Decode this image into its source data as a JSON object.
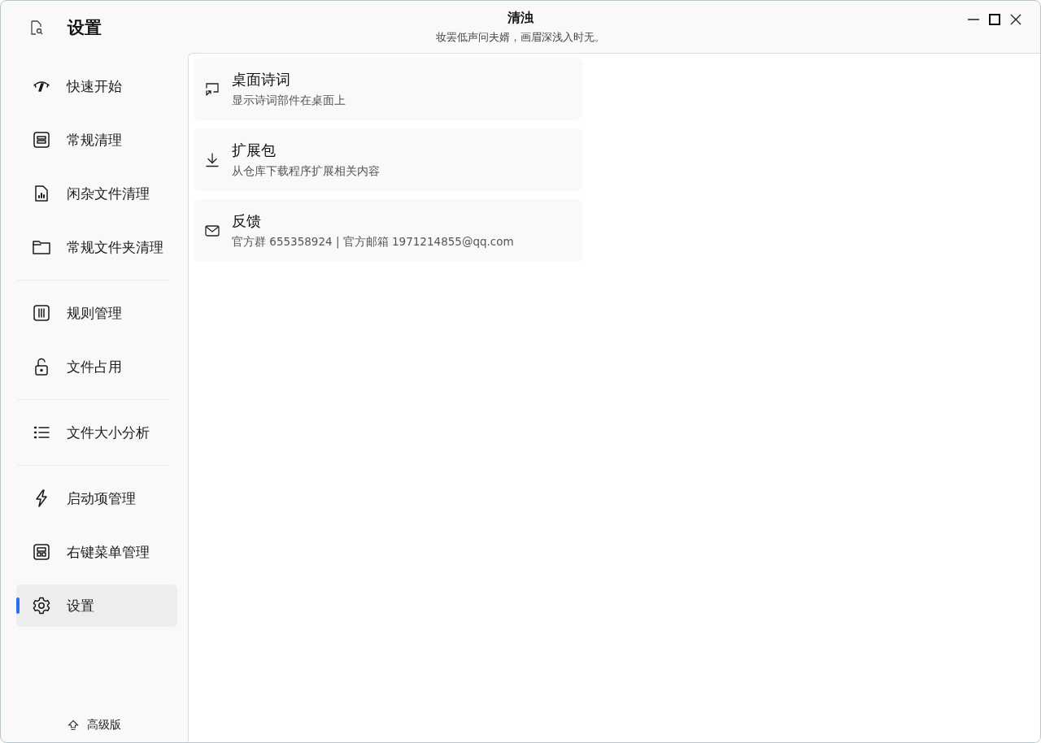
{
  "app": {
    "title": "设置"
  },
  "window": {
    "title": "清浊",
    "subtitle": "妆罢低声问夫婿，画眉深浅入时无。"
  },
  "sidebar": {
    "groups": [
      [
        {
          "label": "快速开始",
          "selected": false
        },
        {
          "label": "常规清理",
          "selected": false
        },
        {
          "label": "闲杂文件清理",
          "selected": false
        },
        {
          "label": "常规文件夹清理",
          "selected": false
        }
      ],
      [
        {
          "label": "规则管理",
          "selected": false
        },
        {
          "label": "文件占用",
          "selected": false
        }
      ],
      [
        {
          "label": "文件大小分析",
          "selected": false
        }
      ],
      [
        {
          "label": "启动项管理",
          "selected": false
        },
        {
          "label": "右键菜单管理",
          "selected": false
        },
        {
          "label": "设置",
          "selected": true
        }
      ]
    ],
    "footer": "高级版"
  },
  "settings": [
    {
      "title": "桌面诗词",
      "description": "显示诗词部件在桌面上"
    },
    {
      "title": "扩展包",
      "description": "从仓库下载程序扩展相关内容"
    },
    {
      "title": "反馈",
      "description": "官方群 655358924 | 官方邮箱 1971214855@qq.com"
    }
  ]
}
